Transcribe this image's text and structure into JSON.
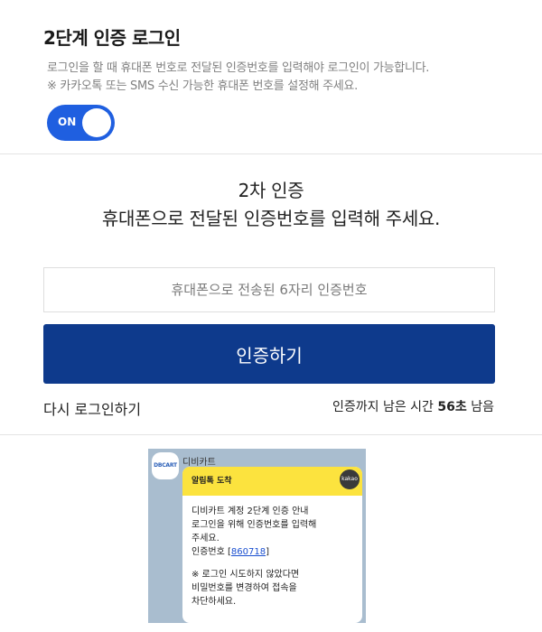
{
  "header": {
    "title": "2단계 인증 로그인",
    "desc_line1": "로그인을 할 때 휴대폰 번호로 전달된 인증번호를 입력해야 로그인이 가능합니다.",
    "desc_line2": "※ 카카오톡 또는 SMS 수신 가능한 휴대폰 번호를 설정해 주세요.",
    "toggle_label": "ON",
    "toggle_color": "#1f5fe0"
  },
  "verify": {
    "heading_line1": "2차 인증",
    "heading_line2": "휴대폰으로 전달된 인증번호를 입력해 주세요.",
    "input_placeholder": "휴대폰으로 전송된 6자리 인증번호",
    "input_value": "",
    "submit_label": "인증하기",
    "submit_color": "#0e3a8c",
    "relogin_label": "다시 로그인하기",
    "timer_prefix": "인증까지 남은 시간",
    "timer_value": "56초",
    "timer_suffix": "남음"
  },
  "kakao_preview": {
    "sender_logo": "DBCART",
    "sender_name": "디비카트",
    "badge": "kakao",
    "header": "알림톡 도착",
    "body_line1": "디비카트 계정 2단계 인증 안내",
    "body_line2": "로그인을 위해 인증번호를 입력해",
    "body_line3": "주세요.",
    "code_label": "인증번호 [",
    "code": "860718",
    "code_suffix": "]",
    "notice_line1": "※ 로그인 시도하지 않았다면",
    "notice_line2": "비밀번호를 변경하여 접속을",
    "notice_line3": "차단하세요.",
    "bg_color": "#a9bdcf",
    "header_color": "#fce33e"
  }
}
